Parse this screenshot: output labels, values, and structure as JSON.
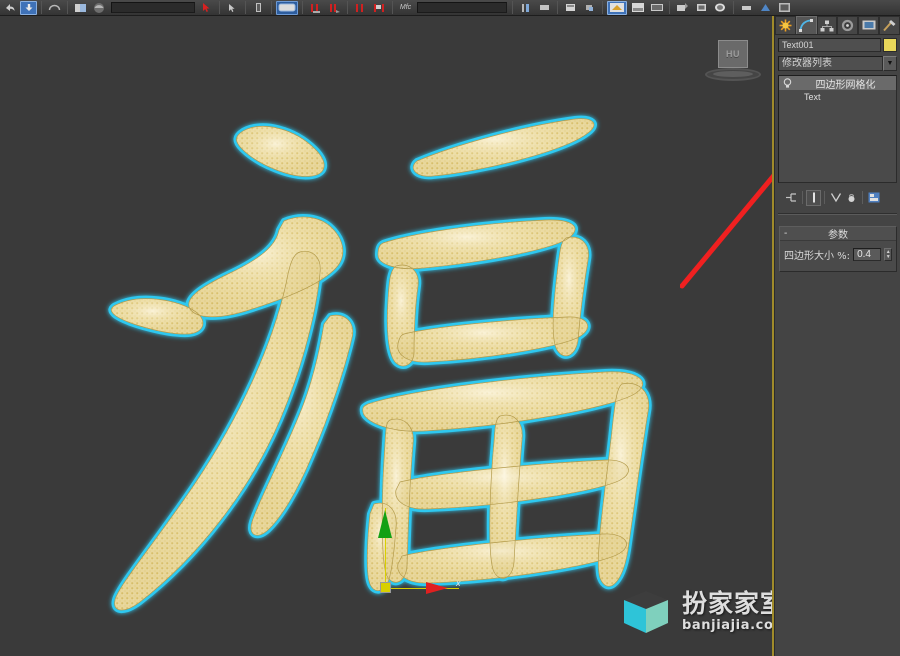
{
  "toolbar": {
    "icons": [
      "undo-icon",
      "redo-icon",
      "select-link-icon",
      "unlink-icon",
      "bind-space-warp-icon",
      "selection-filter-field",
      "select-object-icon",
      "select-by-name-icon",
      "rectangular-selection-region-icon",
      "window-crossing-icon",
      "select-and-move-icon",
      "select-and-rotate-icon",
      "select-and-scale-icon",
      "reference-coordinate-system-field",
      "use-pivot-point-center-icon",
      "select-and-manipulate-icon",
      "snaps-toggle-icon",
      "angle-snap-toggle-icon",
      "percent-snap-toggle-icon",
      "spinner-snap-toggle-icon",
      "edit-named-selection-sets-icon",
      "named-selection-sets-field",
      "mirror-icon",
      "align-icon",
      "layer-manager-icon",
      "graph-editors-icon",
      "curve-editor-icon",
      "schematic-view-icon",
      "material-editor-icon",
      "render-setup-icon",
      "rendered-frame-window-icon",
      "render-production-icon"
    ]
  },
  "viewport": {
    "viewcube_label": "HU",
    "gizmo": {
      "x_axis_label": "x"
    },
    "object_outline_color": "#2ec8f0",
    "mesh_fill_color": "#e2cf86",
    "background_color": "#3a3a3a",
    "character": "福"
  },
  "watermark": {
    "brand_cn": "扮家家室内设计",
    "url": "banjiajia.com",
    "cube_color_left": "#2ec4d8",
    "cube_color_right": "#7fd0bd",
    "cube_color_top": "#3d3d3d"
  },
  "command_panel": {
    "tabs": [
      {
        "name": "create-tab",
        "icon": "star-icon",
        "active": false
      },
      {
        "name": "modify-tab",
        "icon": "arc-icon",
        "active": true
      },
      {
        "name": "hierarchy-tab",
        "icon": "hierarchy-icon",
        "active": false
      },
      {
        "name": "motion-tab",
        "icon": "wheel-icon",
        "active": false
      },
      {
        "name": "display-tab",
        "icon": "monitor-icon",
        "active": false
      },
      {
        "name": "utilities-tab",
        "icon": "hammer-icon",
        "active": false
      }
    ],
    "object_name": "Text001",
    "object_color": "#e8d75a",
    "modifier_list_label": "修改器列表",
    "modifier_stack": [
      {
        "label": "四边形网格化",
        "selected": true,
        "has_bulb": true
      },
      {
        "label": "Text",
        "selected": false,
        "has_bulb": false
      }
    ],
    "stack_tools": [
      "pin-stack-icon",
      "show-end-result-icon",
      "make-unique-icon",
      "remove-modifier-icon",
      "configure-modifier-sets-icon"
    ],
    "rollout": {
      "collapse_symbol": "-",
      "title": "参数",
      "quad_size_label": "四边形大小 %:",
      "quad_size_value": "0.4"
    }
  },
  "annotation": {
    "arrow_color": "#f02020",
    "points_to": "四边形网格化"
  }
}
